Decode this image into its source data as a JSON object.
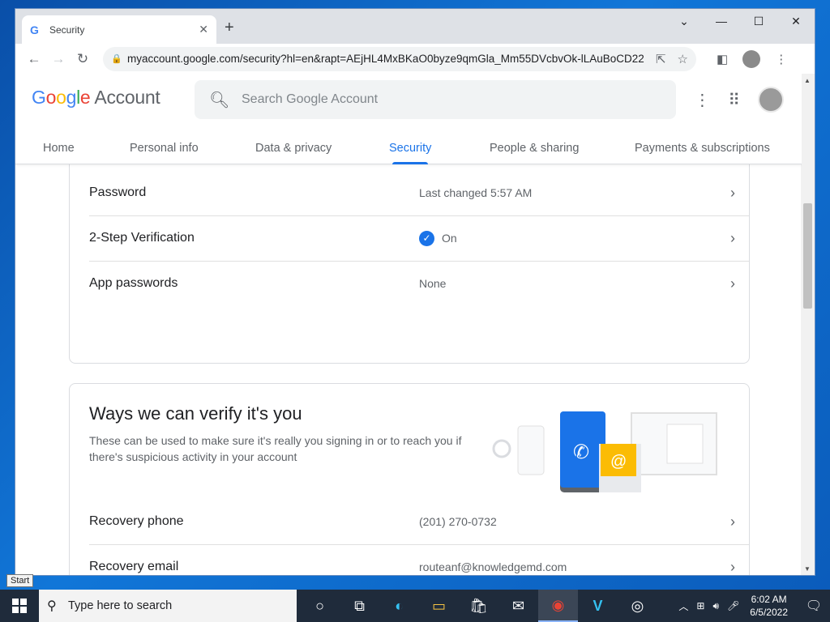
{
  "browser": {
    "tab_title": "Security",
    "tab_favicon": "G",
    "url": "myaccount.google.com/security?hl=en&rapt=AEjHL4MxBKaO0byze9qmGla_Mm55DVcbvOk-lLAuBoCD22..."
  },
  "header": {
    "logo_letters": [
      "G",
      "o",
      "o",
      "g",
      "l",
      "e"
    ],
    "logo_suffix": "Account",
    "search_placeholder": "Search Google Account"
  },
  "nav": {
    "tabs": [
      {
        "label": "Home"
      },
      {
        "label": "Personal info"
      },
      {
        "label": "Data & privacy"
      },
      {
        "label": "Security"
      },
      {
        "label": "People & sharing"
      },
      {
        "label": "Payments & subscriptions"
      }
    ],
    "active": "Security"
  },
  "signin_card": {
    "rows": [
      {
        "label": "Password",
        "value": "Last changed 5:57 AM"
      },
      {
        "label": "2-Step Verification",
        "value": "On"
      },
      {
        "label": "App passwords",
        "value": "None"
      }
    ],
    "password_mask": "**"
  },
  "verify_card": {
    "title": "Ways we can verify it's you",
    "description": "These can be used to make sure it's really you signing in or to reach you if there's suspicious activity in your account",
    "rows": [
      {
        "label": "Recovery phone",
        "value": "(201) 270-0732"
      },
      {
        "label": "Recovery email",
        "value": "routeanf@knowledgemd.com"
      }
    ]
  },
  "taskbar": {
    "start_tooltip": "Start",
    "search_text": "Type here to search",
    "time": "6:02 AM",
    "date": "6/5/2022"
  },
  "colors": {
    "accent": "#1a73e8",
    "taskbar": "#1f2b3b",
    "desktop": "#0b66c4"
  }
}
